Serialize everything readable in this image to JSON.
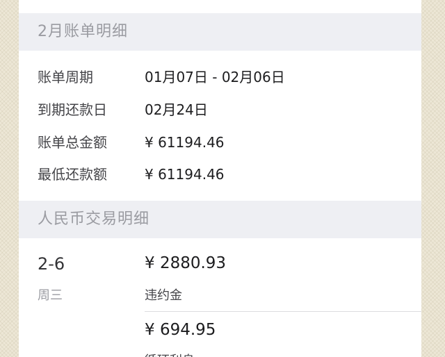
{
  "bill_section": {
    "title": "2月账单明细",
    "rows": [
      {
        "label": "账单周期",
        "value": "01月07日 - 02月06日"
      },
      {
        "label": "到期还款日",
        "value": "02月24日"
      },
      {
        "label": "账单总金额",
        "value": "¥ 61194.46"
      },
      {
        "label": "最低还款额",
        "value": "¥ 61194.46"
      }
    ]
  },
  "transactions_section": {
    "title": "人民币交易明细",
    "days": [
      {
        "date": "2-6",
        "weekday": "周三",
        "items": [
          {
            "amount": "¥ 2880.93",
            "description": "违约金"
          },
          {
            "amount": "¥ 694.95",
            "description": "循环利息"
          }
        ]
      }
    ]
  }
}
